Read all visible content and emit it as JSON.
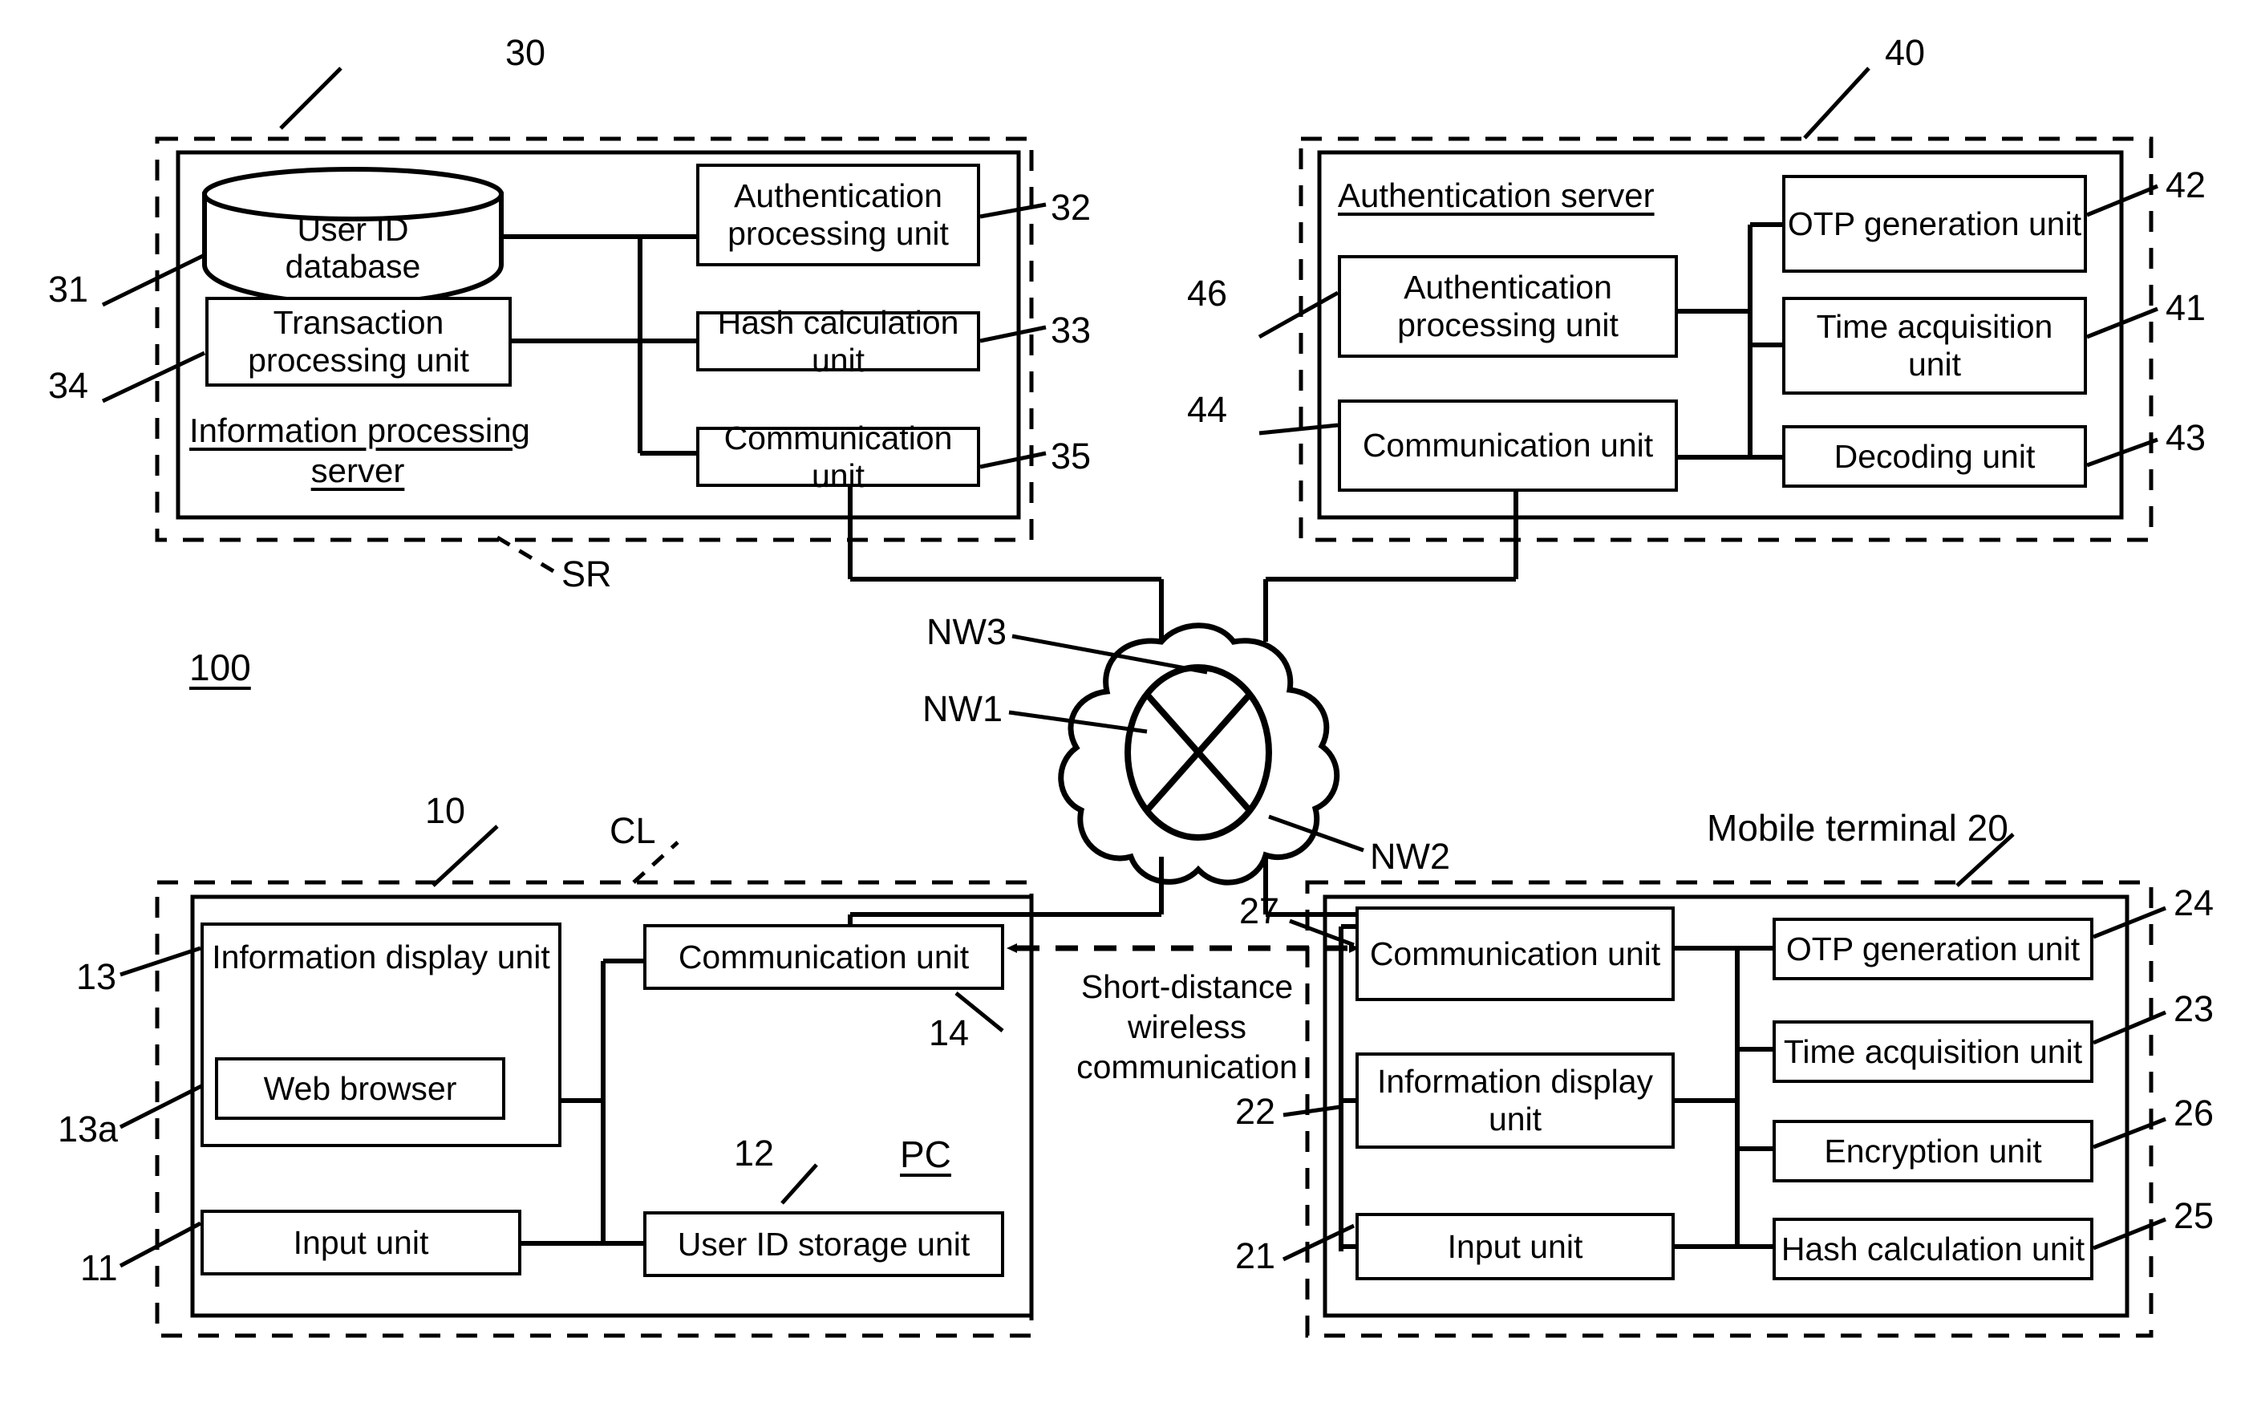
{
  "figure": {
    "system_ref": "100",
    "server_group_ref": "SR",
    "client_group_ref": "CL"
  },
  "info_server": {
    "group_ref": "30",
    "title": "Information processing\nserver",
    "database": {
      "label": "User ID\ndatabase",
      "ref": "31"
    },
    "transaction_unit": {
      "label": "Transaction\nprocessing unit",
      "ref": "34"
    },
    "auth_unit": {
      "label": "Authentication\nprocessing unit",
      "ref": "32"
    },
    "hash_unit": {
      "label": "Hash calculation unit",
      "ref": "33"
    },
    "comm_unit": {
      "label": "Communication unit",
      "ref": "35"
    }
  },
  "auth_server": {
    "group_ref": "40",
    "title": "Authentication server",
    "auth_unit": {
      "label": "Authentication\nprocessing unit",
      "ref": "46"
    },
    "comm_unit": {
      "label": "Communication\nunit",
      "ref": "44"
    },
    "otp_unit": {
      "label": "OTP generation\nunit",
      "ref": "42"
    },
    "time_unit": {
      "label": "Time acquisition\nunit",
      "ref": "41"
    },
    "decoding_unit": {
      "label": "Decoding unit",
      "ref": "43"
    }
  },
  "network": {
    "nw1": "NW1",
    "nw2": "NW2",
    "nw3": "NW3"
  },
  "pc": {
    "group_ref": "10",
    "title": "PC",
    "display_unit": {
      "label": "Information display\nunit",
      "ref": "13"
    },
    "web_browser": {
      "label": "Web browser",
      "ref": "13a"
    },
    "input_unit": {
      "label": "Input unit",
      "ref": "11"
    },
    "comm_unit": {
      "label": "Communication unit",
      "ref": "14"
    },
    "userid_storage": {
      "label": "User ID storage unit",
      "ref": "12"
    }
  },
  "mobile": {
    "title": "Mobile terminal 20",
    "comm_unit": {
      "label": "Communication\nunit",
      "ref": "27"
    },
    "display_unit": {
      "label": "Information display\nunit",
      "ref": "22"
    },
    "input_unit": {
      "label": "Input unit",
      "ref": "21"
    },
    "otp_unit": {
      "label": "OTP generation unit",
      "ref": "24"
    },
    "time_unit": {
      "label": "Time acquisition unit",
      "ref": "23"
    },
    "encryption_unit": {
      "label": "Encryption unit",
      "ref": "26"
    },
    "hash_unit": {
      "label": "Hash calculation unit",
      "ref": "25"
    }
  },
  "link": {
    "short_range": "Short-distance\nwireless\ncommunication"
  },
  "colors": {
    "stroke": "#000000",
    "background": "#ffffff"
  }
}
